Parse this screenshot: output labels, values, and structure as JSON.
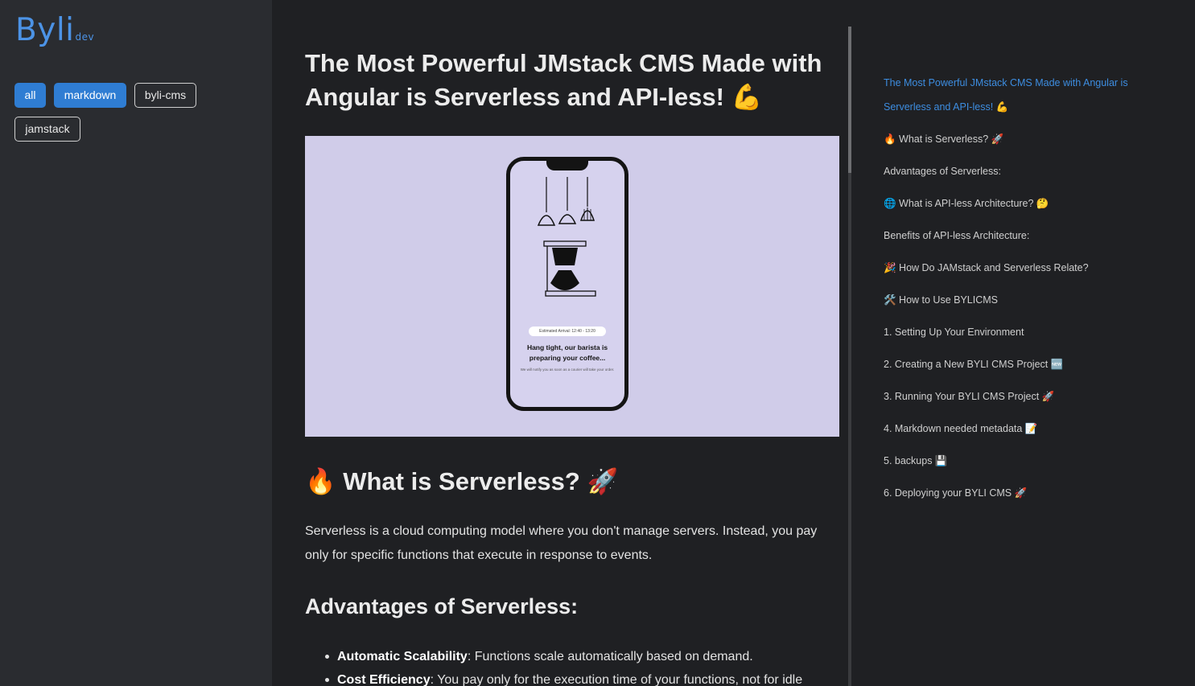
{
  "sidebar": {
    "logo": "Byli",
    "logo_suffix": "dev",
    "tags": [
      {
        "label": "all",
        "active": true
      },
      {
        "label": "markdown",
        "active": true
      },
      {
        "label": "byli-cms",
        "active": false
      },
      {
        "label": "jamstack",
        "active": false
      }
    ]
  },
  "article": {
    "title": "The Most Powerful JMstack CMS Made with Angular is Serverless and API-less! 💪",
    "hero": {
      "eta": "Estimated Arrival: 12:40 - 13:20",
      "heading": "Hang tight, our barista is preparing your coffee...",
      "sub": "We will notify you as soon as a courier will take your order."
    },
    "section_heading": "🔥 What is Serverless? 🚀",
    "paragraph": "Serverless is a cloud computing model where you don't manage servers. Instead, you pay only for specific functions that execute in response to events.",
    "advantages_heading": "Advantages of Serverless:",
    "bullets": [
      {
        "term": "Automatic Scalability",
        "text": ": Functions scale automatically based on demand."
      },
      {
        "term": "Cost Efficiency",
        "text": ": You pay only for the execution time of your functions, not for idle"
      }
    ]
  },
  "toc": {
    "items": [
      {
        "label": "The Most Powerful JMstack CMS Made with Angular is Serverless and API-less! 💪",
        "active": true
      },
      {
        "label": "🔥 What is Serverless? 🚀",
        "active": false
      },
      {
        "label": "Advantages of Serverless:",
        "active": false
      },
      {
        "label": "🌐 What is API-less Architecture? 🤔",
        "active": false
      },
      {
        "label": "Benefits of API-less Architecture:",
        "active": false
      },
      {
        "label": "🎉 How Do JAMstack and Serverless Relate?",
        "active": false
      },
      {
        "label": "🛠️ How to Use BYLICMS",
        "active": false
      },
      {
        "label": "1. Setting Up Your Environment",
        "active": false
      },
      {
        "label": "2. Creating a New BYLI CMS Project 🆕",
        "active": false
      },
      {
        "label": "3. Running Your BYLI CMS Project 🚀",
        "active": false
      },
      {
        "label": "4. Markdown needed metadata 📝",
        "active": false
      },
      {
        "label": "5. backups 💾",
        "active": false
      },
      {
        "label": "6. Deploying your BYLI CMS 🚀",
        "active": false
      }
    ]
  },
  "colors": {
    "accent": "#2f7dd3",
    "logo": "#4c93e6",
    "sidebar_bg": "#2a2c30",
    "page_bg": "#1f2023",
    "toc_active": "#3d8de0"
  }
}
